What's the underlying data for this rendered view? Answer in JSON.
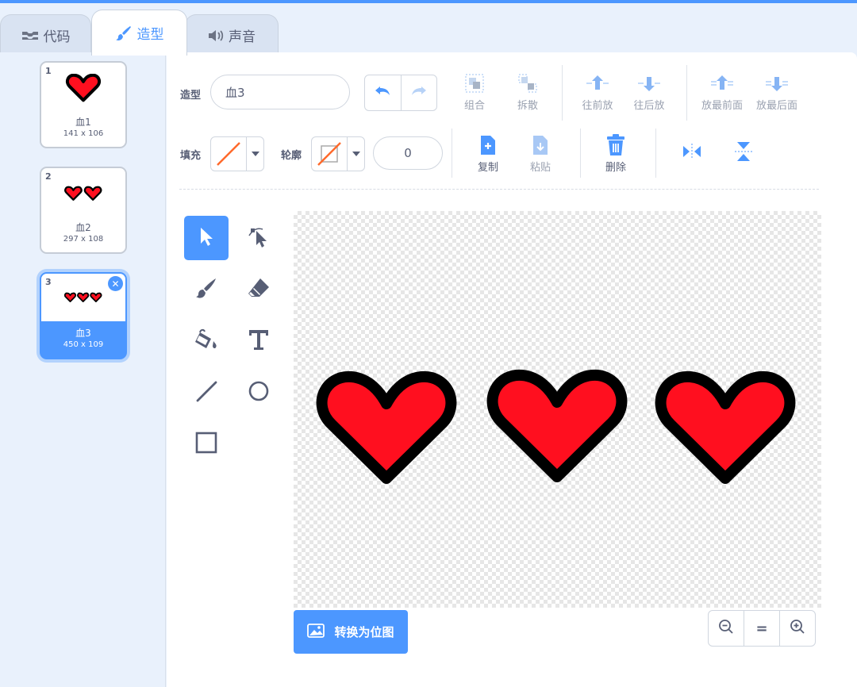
{
  "tabs": [
    {
      "label": "代码",
      "icon": "code-icon",
      "active": false
    },
    {
      "label": "造型",
      "icon": "brush-icon",
      "active": true
    },
    {
      "label": "声音",
      "icon": "sound-icon",
      "active": false
    }
  ],
  "costumes": [
    {
      "index": "1",
      "name": "血1",
      "size": "141 x 106",
      "hearts": 1,
      "selected": false
    },
    {
      "index": "2",
      "name": "血2",
      "size": "297 x 108",
      "hearts": 2,
      "selected": false
    },
    {
      "index": "3",
      "name": "血3",
      "size": "450 x 109",
      "hearts": 3,
      "selected": true
    }
  ],
  "toolbar": {
    "costume_label": "造型",
    "costume_name": "血3",
    "fill_label": "填充",
    "outline_label": "轮廓",
    "outline_width": "0",
    "group_label": "组合",
    "ungroup_label": "拆散",
    "forward_label": "往前放",
    "backward_label": "往后放",
    "front_label": "放最前面",
    "back_label": "放最后面",
    "copy_label": "复制",
    "paste_label": "粘贴",
    "delete_label": "删除"
  },
  "tools": [
    "select-tool",
    "reshape-tool",
    "brush-tool",
    "eraser-tool",
    "fill-tool",
    "text-tool",
    "line-tool",
    "circle-tool",
    "rectangle-tool"
  ],
  "canvas": {
    "hearts": 3
  },
  "convert_button": "转换为位图",
  "zoom": {
    "reset_label": "="
  },
  "colors": {
    "accent": "#4c97ff",
    "heart_fill": "#ff0f1f",
    "heart_outline": "#000000",
    "fill_swatch": "#ff6a2b",
    "text": "#575e75"
  }
}
